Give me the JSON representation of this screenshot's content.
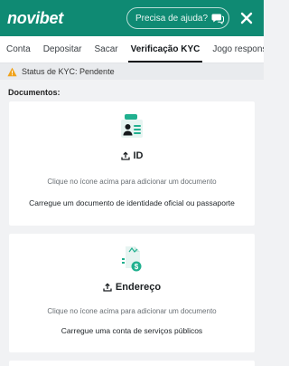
{
  "header": {
    "logo": "novibet",
    "help_label": "Precisa de ajuda?"
  },
  "tabs": [
    {
      "label": "Conta"
    },
    {
      "label": "Depositar"
    },
    {
      "label": "Sacar"
    },
    {
      "label": "Verificação KYC",
      "active": true
    },
    {
      "label": "Jogo responsável"
    }
  ],
  "kyc": {
    "status": "Status de KYC: Pendente"
  },
  "documents": {
    "title": "Documentos:",
    "cards": [
      {
        "icon": "id-card-icon",
        "heading": "ID",
        "hint": "Clique no ícone acima para adicionar um documento",
        "description": "Carregue um documento de identidade oficial ou passaporte"
      },
      {
        "icon": "address-document-icon",
        "heading": "Endereço",
        "hint": "Clique no ícone acima para adicionar um documento",
        "description": "Carregue uma conta de serviços públicos"
      }
    ]
  },
  "colors": {
    "brand": "#0f8a73",
    "accent": "#21b08f",
    "warning": "#f0a21a"
  }
}
